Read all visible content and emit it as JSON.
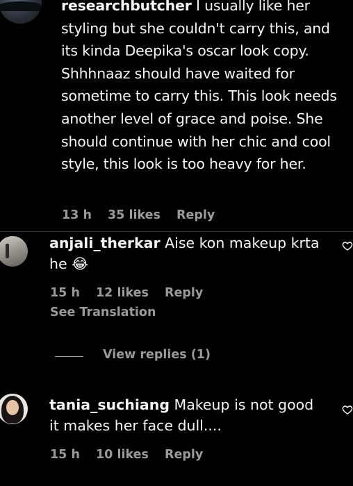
{
  "comments": [
    {
      "username": "researchbutcher",
      "text": "I usually like her styling but she couldn't carry this, and its kinda Deepika's oscar look copy. Shhhnaaz should have waited for sometime to carry this. This look needs another level of grace and poise. She should continue with her chic and cool style, this look is too heavy for her.",
      "time": "13 h",
      "likes": "35 likes",
      "reply_label": "Reply"
    },
    {
      "username": "anjali_therkar",
      "text": "Aise kon makeup krta he 😂",
      "time": "15 h",
      "likes": "12 likes",
      "reply_label": "Reply",
      "translation_label": "See Translation",
      "view_replies_label": "View replies (1)"
    },
    {
      "username": "tania_suchiang",
      "text": "Makeup is not good it makes her face dull....",
      "time": "15 h",
      "likes": "10 likes",
      "reply_label": "Reply"
    }
  ],
  "icons": {
    "like": "heart-outline-icon"
  },
  "colors": {
    "background": "#000000",
    "text": "#f5f5f5",
    "secondary": "#9a9a9a"
  }
}
